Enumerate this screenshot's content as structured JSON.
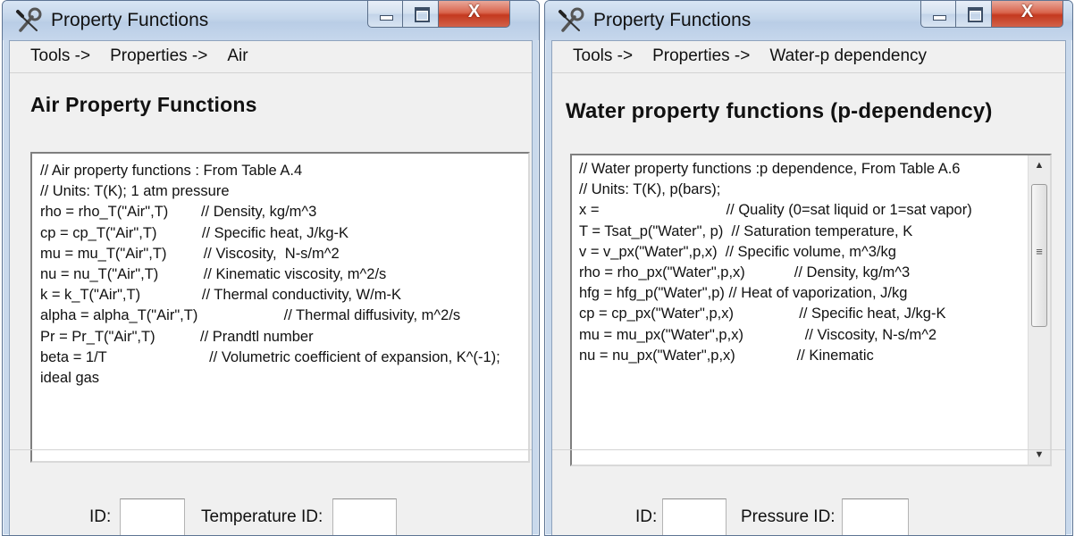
{
  "windows": [
    {
      "title": "Property Functions",
      "breadcrumb": [
        "Tools ->",
        "Properties ->",
        "Air"
      ],
      "heading": "Air Property Functions",
      "code": "// Air property functions : From Table A.4\n// Units: T(K); 1 atm pressure\nrho = rho_T(\"Air\",T)        // Density, kg/m^3\ncp = cp_T(\"Air\",T)           // Specific heat, J/kg-K\nmu = mu_T(\"Air\",T)         // Viscosity,  N-s/m^2\nnu = nu_T(\"Air\",T)           // Kinematic viscosity, m^2/s\nk = k_T(\"Air\",T)               // Thermal conductivity, W/m-K\nalpha = alpha_T(\"Air\",T)                     // Thermal diffusivity, m^2/s\nPr = Pr_T(\"Air\",T)           // Prandtl number\nbeta = 1/T                         // Volumetric coefficient of expansion, K^(-1); ideal gas",
      "id_label": "ID:",
      "id_value": "",
      "second_label": "Temperature ID:",
      "second_value": ""
    },
    {
      "title": "Property Functions",
      "breadcrumb": [
        "Tools ->",
        "Properties ->",
        "Water-p dependency"
      ],
      "heading": "Water property functions (p-dependency)",
      "code": "// Water property functions :p dependence, From Table A.6\n// Units: T(K), p(bars);\nx =                               // Quality (0=sat liquid or 1=sat vapor)\nT = Tsat_p(\"Water\", p)  // Saturation temperature, K\nv = v_px(\"Water\",p,x)  // Specific volume, m^3/kg\nrho = rho_px(\"Water\",p,x)            // Density, kg/m^3\nhfg = hfg_p(\"Water\",p) // Heat of vaporization, J/kg\ncp = cp_px(\"Water\",p,x)                // Specific heat, J/kg-K\nmu = mu_px(\"Water\",p,x)               // Viscosity, N-s/m^2\nnu = nu_px(\"Water\",p,x)               // Kinematic",
      "id_label": "ID:",
      "id_value": "",
      "second_label": "Pressure ID:",
      "second_value": ""
    }
  ],
  "caption": {
    "close_glyph": "X"
  },
  "scrollbar": {
    "up_glyph": "▲",
    "down_glyph": "▼",
    "grip_glyph": "≡"
  },
  "icons": {
    "app": "wrench-screwdriver-icon",
    "minimize": "minimize-icon",
    "maximize": "maximize-icon",
    "close": "close-icon"
  },
  "colors": {
    "frame": "#c9d9ec",
    "close_button": "#c4391f",
    "content_bg": "#f0f0f0"
  }
}
